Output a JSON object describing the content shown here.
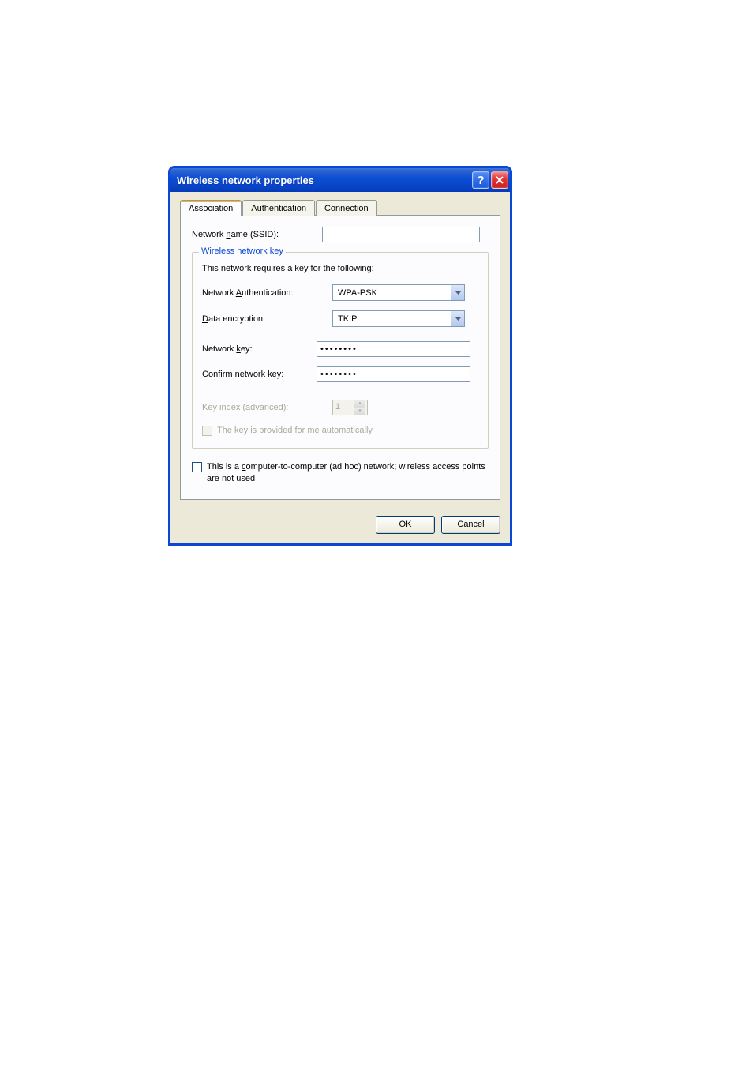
{
  "dialog": {
    "title": "Wireless network properties"
  },
  "tabs": {
    "association": "Association",
    "authentication": "Authentication",
    "connection": "Connection"
  },
  "ssid": {
    "label": "Network name (SSID):",
    "value": ""
  },
  "group": {
    "legend": "Wireless network key",
    "desc": "This network requires a key for the following:",
    "auth": {
      "label": "Network Authentication:",
      "value": "WPA-PSK"
    },
    "encryption": {
      "label": "Data encryption:",
      "value": "TKIP"
    },
    "key": {
      "label": "Network key:",
      "value": "••••••••"
    },
    "confirmkey": {
      "label": "Confirm network key:",
      "value": "••••••••"
    },
    "keyindex": {
      "label": "Key index (advanced):",
      "value": "1"
    },
    "autokey": {
      "label": "The key is provided for me automatically"
    }
  },
  "adhoc": {
    "label": "This is a computer-to-computer (ad hoc) network; wireless access points are not used"
  },
  "buttons": {
    "ok": "OK",
    "cancel": "Cancel"
  }
}
